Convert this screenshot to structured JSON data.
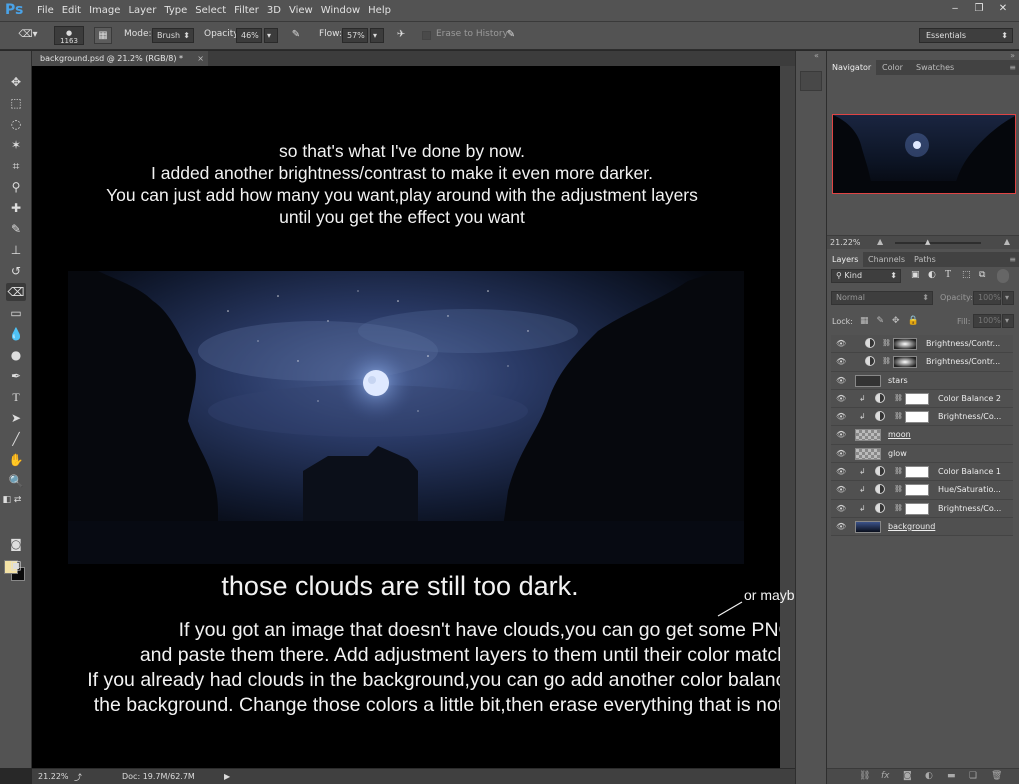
{
  "app": {
    "logo": "Ps"
  },
  "menu": [
    "File",
    "Edit",
    "Image",
    "Layer",
    "Type",
    "Select",
    "Filter",
    "3D",
    "View",
    "Window",
    "Help"
  ],
  "window_controls": {
    "minimize": "‒",
    "restore": "❐",
    "close": "✕"
  },
  "options": {
    "brush_size": "1163",
    "mode_label": "Mode:",
    "mode_value": "Brush",
    "opacity_label": "Opacity:",
    "opacity_value": "46%",
    "flow_label": "Flow:",
    "flow_value": "57%",
    "erase_history": "Erase to History",
    "workspace": "Essentials"
  },
  "document_tab": {
    "title": "background.psd @ 21.2% (RGB/8) *",
    "close": "×"
  },
  "canvas_text": {
    "intro": [
      "so that's what I've done by now.",
      "I added another brightness/contrast to make it even more darker.",
      "You can just add how many you want,play around with the adjustment layers",
      "until you get the effect you want"
    ],
    "heading": "those clouds are still too dark.",
    "side_note": "or maybe some clouds brushes",
    "paragraph": [
      "If you got an image that doesn't have clouds,you can go get some PNG ones",
      "and paste them there. Add adjustment layers to them until their color match the moon.",
      "If you already had clouds in the background,you can go add another color balance layer clipped to",
      "the background. Change those colors a little bit,then erase everything that is not over the clouds."
    ]
  },
  "status": {
    "zoom": "21.22%",
    "doc": "Doc: 19.7M/62.7M"
  },
  "navigator": {
    "tabs": [
      "Navigator",
      "Color",
      "Swatches"
    ],
    "zoom": "21.22%"
  },
  "layers_panel": {
    "tabs": [
      "Layers",
      "Channels",
      "Paths"
    ],
    "kind": "Kind",
    "blend": "Normal",
    "opacity_label": "Opacity:",
    "opacity_value": "100%",
    "lock_label": "Lock:",
    "fill_label": "Fill:",
    "fill_value": "100%",
    "layers": [
      {
        "name": "Brightness/Contr...",
        "type": "adj",
        "clipped": false
      },
      {
        "name": "Brightness/Contr...",
        "type": "adj",
        "clipped": false
      },
      {
        "name": "stars",
        "type": "pixel",
        "clipped": false
      },
      {
        "name": "Color Balance 2",
        "type": "adj",
        "clipped": true
      },
      {
        "name": "Brightness/Co...",
        "type": "adj",
        "clipped": true
      },
      {
        "name": "moon",
        "type": "pixel",
        "clipped": false
      },
      {
        "name": "glow",
        "type": "pixel",
        "clipped": false
      },
      {
        "name": "Color Balance 1",
        "type": "adj",
        "clipped": true
      },
      {
        "name": "Hue/Saturatio...",
        "type": "adj",
        "clipped": true
      },
      {
        "name": "Brightness/Co...",
        "type": "adj",
        "clipped": true
      },
      {
        "name": "background",
        "type": "pixel",
        "clipped": false
      }
    ]
  }
}
